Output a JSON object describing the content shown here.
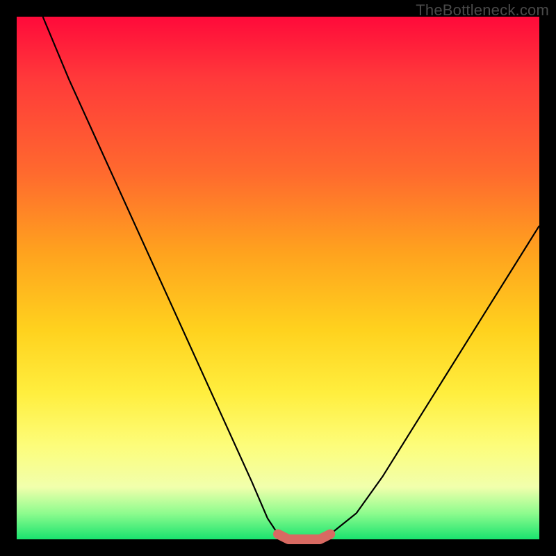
{
  "watermark": "TheBottleneck.com",
  "chart_data": {
    "type": "line",
    "title": "",
    "xlabel": "",
    "ylabel": "",
    "xlim": [
      0,
      100
    ],
    "ylim": [
      0,
      100
    ],
    "grid": false,
    "legend": false,
    "series": [
      {
        "name": "bottleneck-curve",
        "x": [
          5,
          10,
          15,
          20,
          25,
          30,
          35,
          40,
          45,
          48,
          50,
          52,
          54,
          56,
          58,
          60,
          65,
          70,
          75,
          80,
          85,
          90,
          95,
          100
        ],
        "y": [
          100,
          88,
          77,
          66,
          55,
          44,
          33,
          22,
          11,
          4,
          1,
          0,
          0,
          0,
          0,
          1,
          5,
          12,
          20,
          28,
          36,
          44,
          52,
          60
        ]
      },
      {
        "name": "min-band",
        "x": [
          50,
          52,
          54,
          56,
          58,
          60
        ],
        "y": [
          1,
          0,
          0,
          0,
          0,
          1
        ]
      }
    ],
    "colors": {
      "curve": "#000000",
      "band": "#d86a62"
    }
  }
}
